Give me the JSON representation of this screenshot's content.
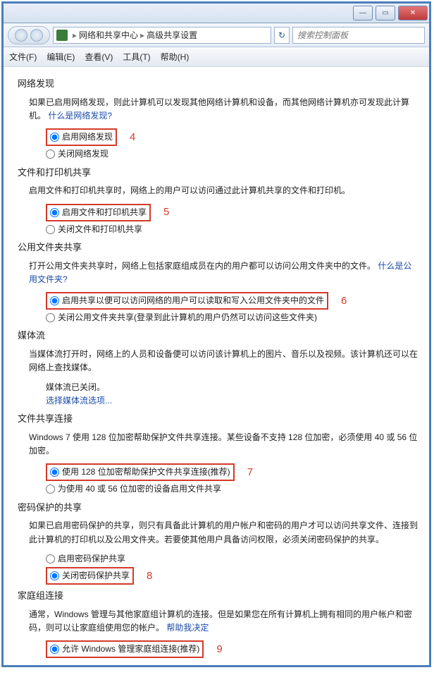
{
  "titlebar": {
    "min": "—",
    "max": "▭",
    "close": "✕"
  },
  "breadcrumb": {
    "seg1": "网络和共享中心",
    "seg2": "高级共享设置",
    "sep": "▸"
  },
  "search": {
    "placeholder": "搜索控制面板"
  },
  "menu": {
    "file": "文件(F)",
    "edit": "编辑(E)",
    "view": "查看(V)",
    "tools": "工具(T)",
    "help": "帮助(H)"
  },
  "s_net": {
    "title": "网络发现",
    "desc": "如果已启用网络发现，则此计算机可以发现其他网络计算机和设备，而其他网络计算机亦可发现此计算机。",
    "link": "什么是网络发现?",
    "on": "启用网络发现",
    "off": "关闭网络发现",
    "annot": "4"
  },
  "s_fp": {
    "title": "文件和打印机共享",
    "desc": "启用文件和打印机共享时，网络上的用户可以访问通过此计算机共享的文件和打印机。",
    "on": "启用文件和打印机共享",
    "off": "关闭文件和打印机共享",
    "annot": "5"
  },
  "s_pub": {
    "title": "公用文件夹共享",
    "desc_a": "打开公用文件夹共享时，网络上包括家庭组成员在内的用户都可以访问公用文件夹中的文件。",
    "link": "什么是公用文件夹?",
    "on": "启用共享以便可以访问网络的用户可以读取和写入公用文件夹中的文件",
    "off": "关闭公用文件夹共享(登录到此计算机的用户仍然可以访问这些文件夹)",
    "annot": "6"
  },
  "s_media": {
    "title": "媒体流",
    "desc": "当媒体流打开时，网络上的人员和设备便可以访问该计算机上的图片、音乐以及视频。该计算机还可以在网络上查找媒体。",
    "status": "媒体流已关闭。",
    "link": "选择媒体流选项..."
  },
  "s_enc": {
    "title": "文件共享连接",
    "desc": "Windows 7 使用 128 位加密帮助保护文件共享连接。某些设备不支持 128 位加密，必须使用 40 或 56 位加密。",
    "on": "使用 128 位加密帮助保护文件共享连接(推荐)",
    "off": "为使用 40 或 56 位加密的设备启用文件共享",
    "annot": "7"
  },
  "s_pwd": {
    "title": "密码保护的共享",
    "desc": "如果已启用密码保护的共享，则只有具备此计算机的用户帐户和密码的用户才可以访问共享文件、连接到此计算机的打印机以及公用文件夹。若要使其他用户具备访问权限，必须关闭密码保护的共享。",
    "on": "启用密码保护共享",
    "off": "关闭密码保护共享",
    "annot": "8"
  },
  "s_home": {
    "title": "家庭组连接",
    "desc_a": "通常，Windows 管理与其他家庭组计算机的连接。但是如果您在所有计算机上拥有相同的用户帐户和密码，则可以让家庭组使用您的帐户。",
    "link": "帮助我决定",
    "on": "允许 Windows 管理家庭组连接(推荐)",
    "annot": "9"
  }
}
